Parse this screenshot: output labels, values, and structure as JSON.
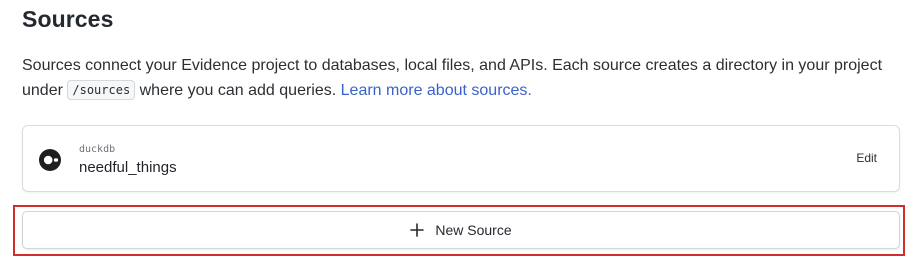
{
  "page": {
    "title": "Sources",
    "description_before": "Sources connect your Evidence project to databases, local files, and APIs. Each source creates a directory in your project under ",
    "code_path": "/sources",
    "description_after": " where you can add queries. ",
    "learn_more_link": "Learn more about sources."
  },
  "sources": [
    {
      "type": "duckdb",
      "name": "needful_things",
      "icon": "duckdb-icon",
      "edit_label": "Edit"
    }
  ],
  "actions": {
    "new_source_label": "New Source",
    "new_source_icon": "plus-icon"
  },
  "colors": {
    "link": "#3b62c9",
    "highlight": "#d22c2c"
  }
}
